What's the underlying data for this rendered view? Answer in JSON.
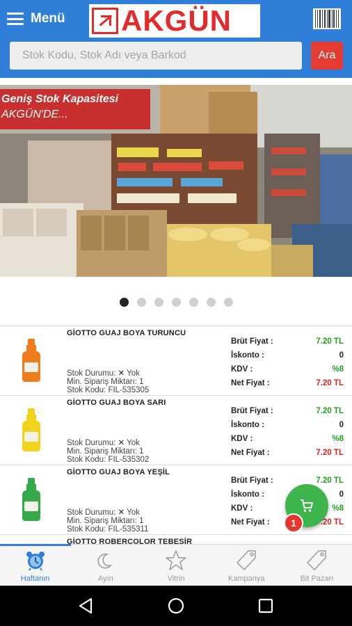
{
  "header": {
    "menu_label": "Menü",
    "brand": "AKGÜN",
    "search_placeholder": "Stok Kodu, Stok Adı veya Barkod",
    "search_button": "Ara",
    "colors": {
      "header_bg": "#2f7ed8",
      "brand_red": "#e22b2b",
      "search_button": "#e63b32"
    }
  },
  "banner": {
    "line1": "Geniş Stok Kapasitesi",
    "line2": "AKGÜN'DE...",
    "slide_count": 7,
    "active_slide": 1
  },
  "products": [
    {
      "name": "GİOTTO GUAJ BOYA TURUNCU",
      "stock_status": "Stok Durumu:",
      "stock_value": "Yok",
      "min_order": "Min. Sipariş Miktarı: 1",
      "stock_code": "Stok Kodu: FIL-535305",
      "bottle_color": "#f07c1e",
      "prices": {
        "brut_label": "Brüt Fiyat :",
        "brut": "7.20 TL",
        "iskonto_label": "İskonto :",
        "iskonto": "0",
        "kdv_label": "KDV :",
        "kdv": "%8",
        "net_label": "Net Fiyat :",
        "net": "7.20 TL"
      }
    },
    {
      "name": "GİOTTO GUAJ BOYA SARI",
      "stock_status": "Stok Durumu:",
      "stock_value": "Yok",
      "min_order": "Min. Sipariş Miktarı: 1",
      "stock_code": "Stok Kodu: FIL-535302",
      "bottle_color": "#f2d21b",
      "prices": {
        "brut_label": "Brüt Fiyat :",
        "brut": "7.20 TL",
        "iskonto_label": "İskonto :",
        "iskonto": "0",
        "kdv_label": "KDV :",
        "kdv": "%8",
        "net_label": "Net Fiyat :",
        "net": "7.20 TL"
      }
    },
    {
      "name": "GİOTTO GUAJ BOYA YEŞİL",
      "stock_status": "Stok Durumu:",
      "stock_value": "Yok",
      "min_order": "Min. Sipariş Miktarı: 1",
      "stock_code": "Stok Kodu: FIL-535311",
      "bottle_color": "#34a84a",
      "prices": {
        "brut_label": "Brüt Fiyat :",
        "brut": "7.20 TL",
        "iskonto_label": "İskonto :",
        "iskonto": "0",
        "kdv_label": "KDV :",
        "kdv": "%8",
        "net_label": "Net Fiyat :",
        "net": "7.20 TL"
      }
    },
    {
      "name": "GİOTTO ROBERCOLOR TEBEŞİR"
    }
  ],
  "cart": {
    "count": "1",
    "color": "#3db54a",
    "icon": "cart-icon"
  },
  "tabs": [
    {
      "label": "Haftanın",
      "icon": "alarm-clock-icon",
      "active": true
    },
    {
      "label": "Ayın",
      "icon": "moon-icon",
      "active": false
    },
    {
      "label": "Vitrin",
      "icon": "star-icon",
      "active": false
    },
    {
      "label": "Kampanya",
      "icon": "tag-icon",
      "active": false
    },
    {
      "label": "Bit Pazarı",
      "icon": "tag-icon",
      "active": false
    }
  ],
  "system_nav": [
    "back-icon",
    "home-icon",
    "recents-icon"
  ]
}
